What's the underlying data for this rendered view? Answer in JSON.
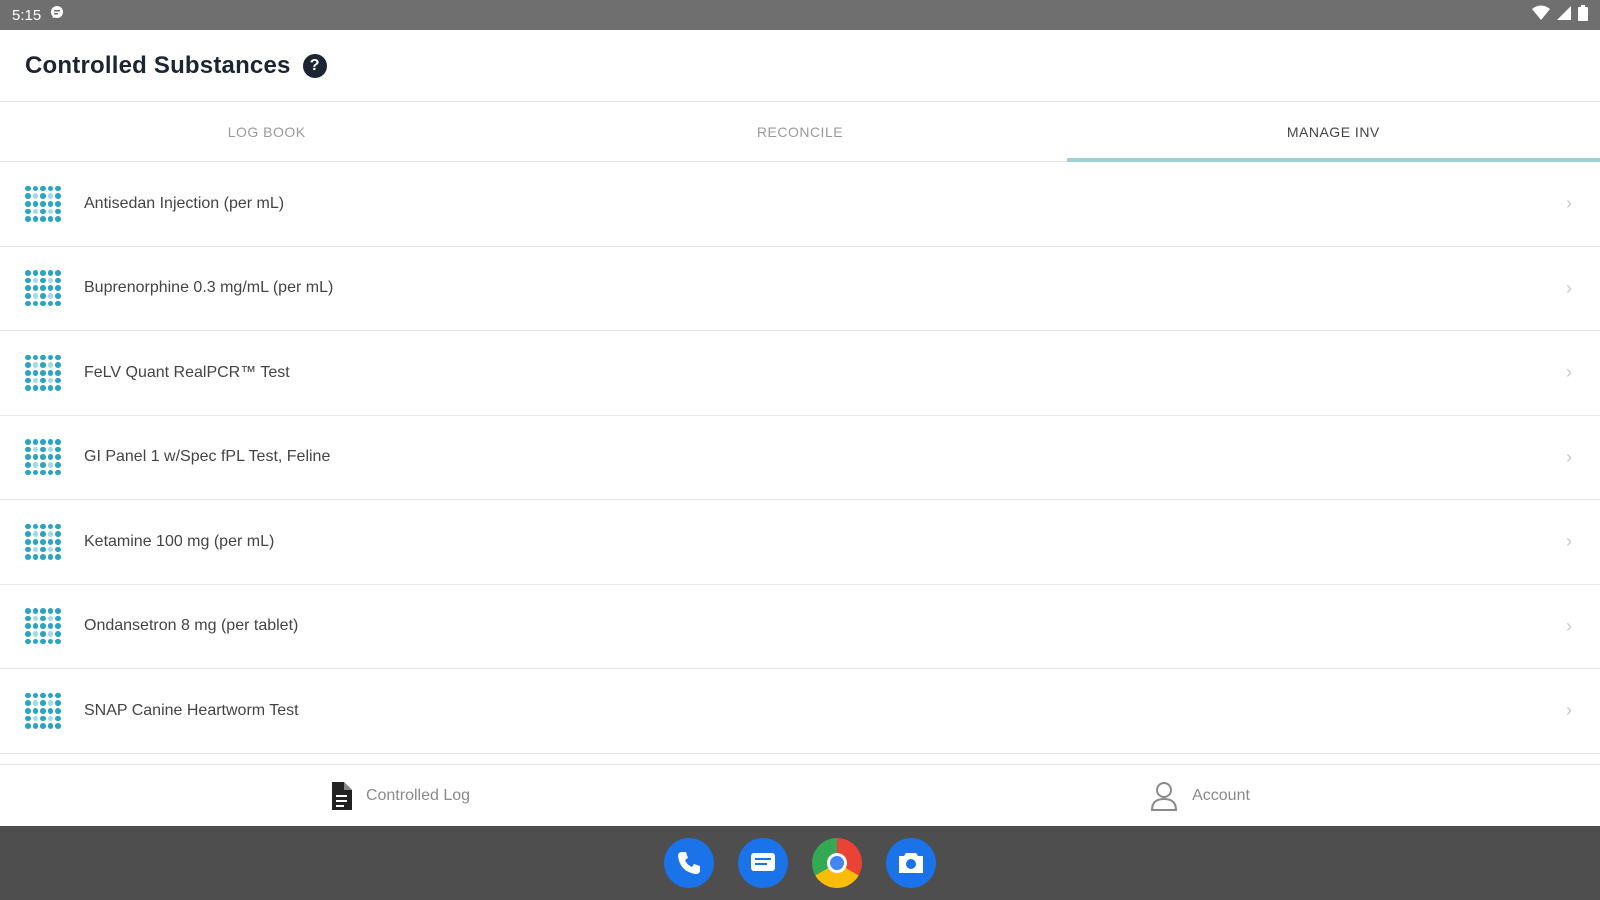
{
  "status_bar": {
    "time": "5:15",
    "icons": [
      "message-notification-icon",
      "wifi-icon",
      "signal-icon",
      "battery-icon"
    ]
  },
  "header": {
    "title": "Controlled Substances",
    "help_icon": "question-mark-icon"
  },
  "tabs": [
    {
      "label": "LOG BOOK",
      "active": false
    },
    {
      "label": "RECONCILE",
      "active": false
    },
    {
      "label": "MANAGE INV",
      "active": true
    }
  ],
  "inventory": {
    "items": [
      {
        "label": "Antisedan Injection (per mL)"
      },
      {
        "label": "Buprenorphine 0.3 mg/mL (per mL)"
      },
      {
        "label": "FeLV Quant RealPCR™ Test"
      },
      {
        "label": "GI Panel 1 w/Spec fPL Test, Feline"
      },
      {
        "label": "Ketamine 100 mg (per mL)"
      },
      {
        "label": "Ondansetron 8 mg (per tablet)"
      },
      {
        "label": "SNAP Canine Heartworm Test"
      }
    ]
  },
  "bottom_nav": {
    "controlled_log": "Controlled Log",
    "account": "Account"
  },
  "dock": {
    "apps": [
      "phone-icon",
      "messages-icon",
      "chrome-icon",
      "camera-icon"
    ]
  },
  "colors": {
    "accent_tab_underline": "#9fd3d3",
    "item_icon_blue": "#2ba3c4",
    "title_dark": "#1c2533",
    "status_bar": "#6f6f6f",
    "dock": "#4e4e4e"
  }
}
